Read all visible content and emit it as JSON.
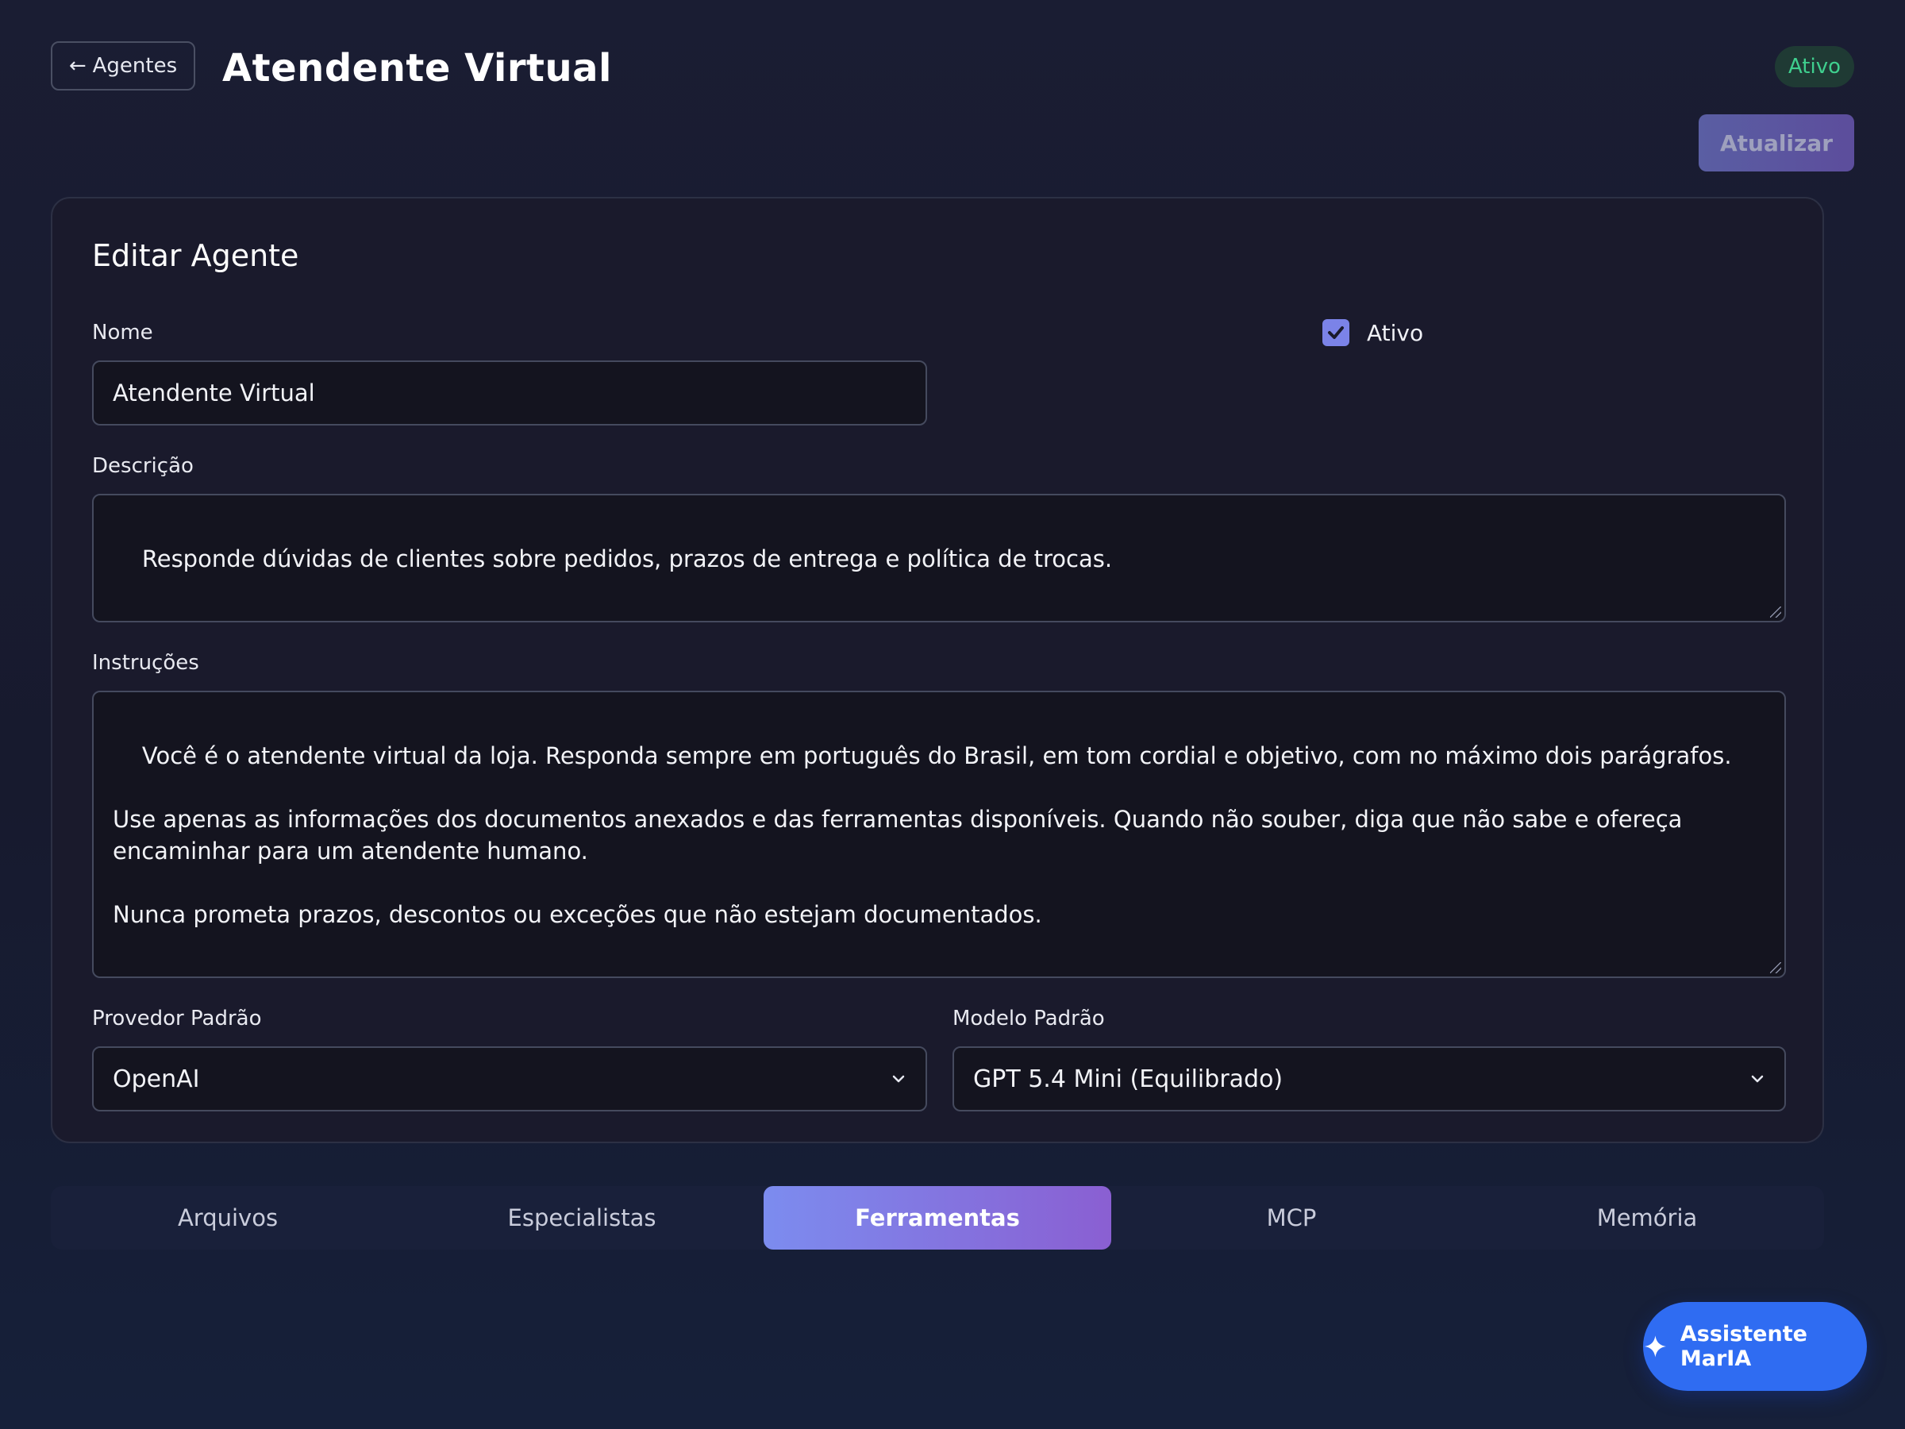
{
  "header": {
    "back_arrow": "←",
    "back_label": "Agentes",
    "title": "Atendente Virtual",
    "status_badge": "Ativo",
    "update_label": "Atualizar"
  },
  "form": {
    "title": "Editar Agente",
    "name_label": "Nome",
    "name_value": "Atendente Virtual",
    "active_label": "Ativo",
    "active_checked": true,
    "description_label": "Descrição",
    "description_value": "Responde dúvidas de clientes sobre pedidos, prazos de entrega e política de trocas.",
    "instructions_label": "Instruções",
    "instructions_value": "Você é o atendente virtual da loja. Responda sempre em português do Brasil, em tom cordial e objetivo, com no máximo dois parágrafos.\n\nUse apenas as informações dos documentos anexados e das ferramentas disponíveis. Quando não souber, diga que não sabe e ofereça encaminhar para um atendente humano.\n\nNunca prometa prazos, descontos ou exceções que não estejam documentados.",
    "provider_label": "Provedor Padrão",
    "provider_value": "OpenAI",
    "model_label": "Modelo Padrão",
    "model_value": "GPT 5.4 Mini (Equilibrado)"
  },
  "tabs": [
    {
      "label": "Arquivos",
      "active": false
    },
    {
      "label": "Especialistas",
      "active": false
    },
    {
      "label": "Ferramentas",
      "active": true
    },
    {
      "label": "MCP",
      "active": false
    },
    {
      "label": "Memória",
      "active": false
    }
  ],
  "assistant": {
    "label": "Assistente MarIA",
    "icon": "sparkle-icon"
  },
  "colors": {
    "background": "#1a1d33",
    "status_green": "#3fcf8e",
    "accent_start": "#7c8cef",
    "accent_end": "#8a5fd2",
    "assistant_blue": "#2f6cf2"
  }
}
